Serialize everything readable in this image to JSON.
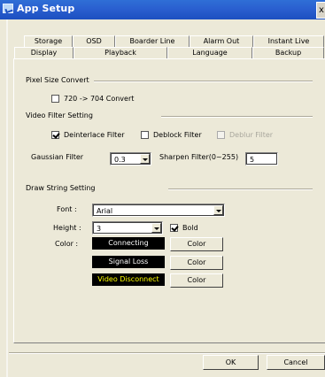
{
  "window": {
    "title": "App Setup",
    "close_glyph": "x"
  },
  "tabs_row1": [
    "Storage",
    "OSD",
    "Boarder Line",
    "Alarm Out",
    "Instant Live"
  ],
  "tabs_row2": [
    "Display",
    "Playback",
    "Language",
    "Backup"
  ],
  "selected_tab": "Display",
  "pixel_size": {
    "group_label": "Pixel Size Convert",
    "convert_label": "720 -> 704 Convert",
    "convert_checked": false
  },
  "video_filter": {
    "group_label": "Video Filter Setting",
    "deinterlace_label": "Deinterlace Filter",
    "deinterlace_checked": true,
    "deblock_label": "Deblock Filter",
    "deblock_checked": false,
    "deblur_label": "Deblur Filter",
    "deblur_checked": false,
    "deblur_enabled": false,
    "gaussian_label": "Gaussian Filter",
    "gaussian_value": "0.3",
    "sharpen_label": "Sharpen Filter(0~255)",
    "sharpen_value": "5"
  },
  "draw_string": {
    "group_label": "Draw String Setting",
    "font_label": "Font :",
    "font_value": "Arial",
    "height_label": "Height :",
    "height_value": "3",
    "bold_label": "Bold",
    "bold_checked": true,
    "color_label": "Color :",
    "items": [
      {
        "text": "Connecting",
        "text_color": "#ffffff",
        "button": "Color"
      },
      {
        "text": "Signal Loss",
        "text_color": "#ffffff",
        "button": "Color"
      },
      {
        "text": "Video Disconnect",
        "text_color": "#ffff00",
        "button": "Color"
      }
    ]
  },
  "buttons": {
    "ok": "OK",
    "cancel": "Cancel"
  },
  "colors": {
    "titlebar": "#2a5fd0",
    "dialog_bg": "#ece9d8",
    "swatch_bg": "#000000"
  }
}
